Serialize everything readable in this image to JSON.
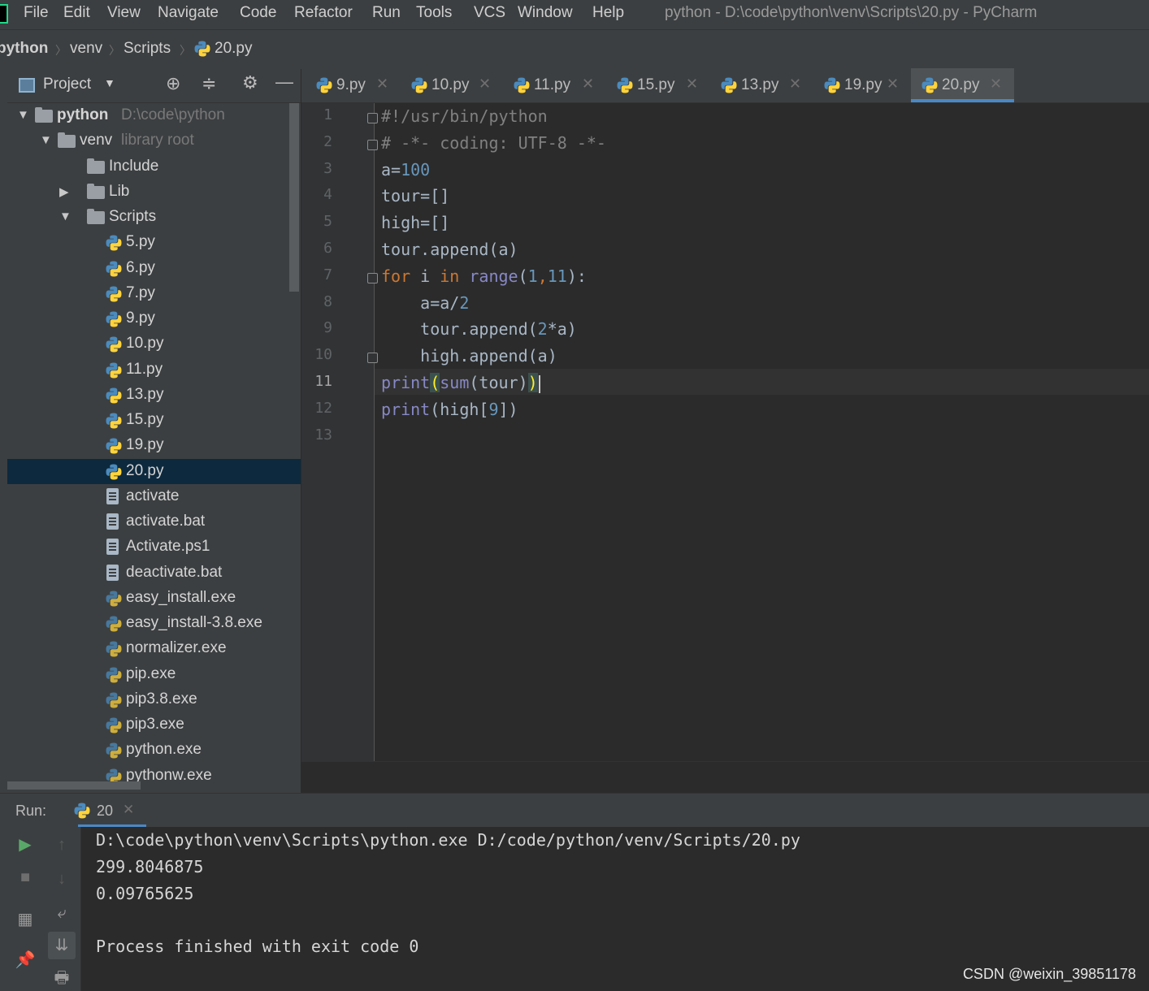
{
  "menubar": {
    "app_logo": "PC",
    "items": [
      "File",
      "Edit",
      "View",
      "Navigate",
      "Code",
      "Refactor",
      "Run",
      "Tools",
      "VCS",
      "Window",
      "Help"
    ],
    "window_title": "python - D:\\code\\python\\venv\\Scripts\\20.py - PyCharm"
  },
  "breadcrumb": [
    "python",
    "venv",
    "Scripts",
    "20.py"
  ],
  "project_panel": {
    "title": "Project",
    "tree": [
      {
        "label": "python",
        "hint": "D:\\code\\python",
        "type": "folder",
        "depth": 0,
        "expanded": true
      },
      {
        "label": "venv",
        "hint": "library root",
        "type": "folder",
        "depth": 1,
        "expanded": true
      },
      {
        "label": "Include",
        "hint": "",
        "type": "folder",
        "depth": 2
      },
      {
        "label": "Lib",
        "hint": "",
        "type": "folder",
        "depth": 2,
        "expanded": false
      },
      {
        "label": "Scripts",
        "hint": "",
        "type": "folder",
        "depth": 2,
        "expanded": true
      },
      {
        "label": "5.py",
        "type": "py",
        "depth": 3
      },
      {
        "label": "6.py",
        "type": "py",
        "depth": 3
      },
      {
        "label": "7.py",
        "type": "py",
        "depth": 3
      },
      {
        "label": "9.py",
        "type": "py",
        "depth": 3
      },
      {
        "label": "10.py",
        "type": "py",
        "depth": 3
      },
      {
        "label": "11.py",
        "type": "py",
        "depth": 3
      },
      {
        "label": "13.py",
        "type": "py",
        "depth": 3
      },
      {
        "label": "15.py",
        "type": "py",
        "depth": 3
      },
      {
        "label": "19.py",
        "type": "py",
        "depth": 3
      },
      {
        "label": "20.py",
        "type": "py",
        "depth": 3,
        "selected": true
      },
      {
        "label": "activate",
        "type": "text",
        "depth": 3
      },
      {
        "label": "activate.bat",
        "type": "text",
        "depth": 3
      },
      {
        "label": "Activate.ps1",
        "type": "text",
        "depth": 3
      },
      {
        "label": "deactivate.bat",
        "type": "text",
        "depth": 3
      },
      {
        "label": "easy_install.exe",
        "type": "exe",
        "depth": 3
      },
      {
        "label": "easy_install-3.8.exe",
        "type": "exe",
        "depth": 3
      },
      {
        "label": "normalizer.exe",
        "type": "exe",
        "depth": 3
      },
      {
        "label": "pip.exe",
        "type": "exe",
        "depth": 3
      },
      {
        "label": "pip3.8.exe",
        "type": "exe",
        "depth": 3
      },
      {
        "label": "pip3.exe",
        "type": "exe",
        "depth": 3
      },
      {
        "label": "python.exe",
        "type": "exe",
        "depth": 3
      },
      {
        "label": "pythonw.exe",
        "type": "exe",
        "depth": 3
      }
    ]
  },
  "tabs": [
    {
      "label": "9.py",
      "active": false
    },
    {
      "label": "10.py",
      "active": false
    },
    {
      "label": "11.py",
      "active": false
    },
    {
      "label": "15.py",
      "active": false
    },
    {
      "label": "13.py",
      "active": false
    },
    {
      "label": "19.py",
      "active": false
    },
    {
      "label": "20.py",
      "active": true
    }
  ],
  "editor": {
    "current_line": 11,
    "lines": [
      [
        [
          "c",
          "#!/usr/bin/python"
        ]
      ],
      [
        [
          "c",
          "# -*- coding: UTF-8 -*-"
        ]
      ],
      [
        [
          "p",
          "a="
        ],
        [
          "n",
          "100"
        ]
      ],
      [
        [
          "p",
          "tour=[]"
        ]
      ],
      [
        [
          "p",
          "high=[]"
        ]
      ],
      [
        [
          "p",
          "tour.append(a)"
        ]
      ],
      [
        [
          "k",
          "for"
        ],
        [
          "p",
          " i "
        ],
        [
          "k",
          "in"
        ],
        [
          "p",
          " "
        ],
        [
          "b",
          "range"
        ],
        [
          "p",
          "("
        ],
        [
          "n",
          "1"
        ],
        [
          "k",
          ","
        ],
        [
          "n",
          "11"
        ],
        [
          "p",
          "):"
        ]
      ],
      [
        [
          "p",
          "    a=a/"
        ],
        [
          "n",
          "2"
        ]
      ],
      [
        [
          "p",
          "    tour.append("
        ],
        [
          "n",
          "2"
        ],
        [
          "p",
          "*a)"
        ]
      ],
      [
        [
          "p",
          "    high.append(a)"
        ]
      ],
      [
        [
          "b",
          "print"
        ],
        [
          "m",
          "("
        ],
        [
          "b",
          "sum"
        ],
        [
          "p",
          "(tour)"
        ],
        [
          "m",
          ")"
        ],
        [
          "caret",
          ""
        ]
      ],
      [
        [
          "b",
          "print"
        ],
        [
          "p",
          "(high["
        ],
        [
          "n",
          "9"
        ],
        [
          "p",
          "])"
        ]
      ],
      []
    ],
    "fold_lines": [
      1,
      2,
      7,
      10
    ]
  },
  "run_panel": {
    "title": "Run:",
    "tab_label": "20",
    "console": [
      "D:\\code\\python\\venv\\Scripts\\python.exe D:/code/python/venv/Scripts/20.py",
      "299.8046875",
      "0.09765625",
      "",
      "Process finished with exit code 0"
    ]
  },
  "watermark": "CSDN @weixin_39851178",
  "colors": {
    "keyword": "#cc7832",
    "number": "#6897bb",
    "builtin": "#8888c6",
    "comment": "#808080",
    "selection": "#0d293e",
    "accent": "#4a88c7"
  }
}
